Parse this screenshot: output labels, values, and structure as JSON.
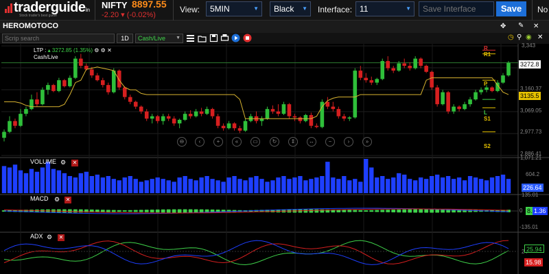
{
  "header": {
    "logo_text": "traderguide",
    "logo_suffix": "in",
    "logo_tagline": "Stock trader's best guide",
    "ticker_name": "NIFTY",
    "ticker_price": "8897.55",
    "ticker_change": "-2.20 ▾ (-0.02%)",
    "view_label": "View:",
    "view_value": "5MIN",
    "theme_value": "Black",
    "interface_label": "Interface:",
    "interface_value": "11",
    "save_placeholder": "Save Interface",
    "save_label": "Save",
    "clipped_label": "No"
  },
  "chart": {
    "symbol": "HEROMOTOCO",
    "search_placeholder": "Scrip search",
    "timeframe": "1D",
    "mode": "Cash/Live",
    "ltp_label": "LTP :",
    "ltp_change": "▴ 3272.85 (1.35%)",
    "ltp_mode": "Cash/Live"
  },
  "price_axis": {
    "ticks": [
      "3,343",
      "3,251.6",
      "3,160.37",
      "3,069.05",
      "2,977.73",
      "2,886.41"
    ],
    "ltp_tag": "3272.8",
    "ma_tag": "3135.5"
  },
  "pivots": {
    "labels": [
      "R",
      "R1",
      "P",
      "L",
      "S1",
      "S2"
    ],
    "colors": {
      "R": "#e03030",
      "R1": "#e6c200",
      "P": "#e6c200",
      "L": "#3fd34a",
      "S1": "#e6c200",
      "S2": "#e6c200"
    }
  },
  "panels": {
    "volume": {
      "title": "VOLUME",
      "ticks": [
        "1,071.21",
        "604.2"
      ],
      "tag": "226.64"
    },
    "macd": {
      "title": "MACD",
      "ticks": [
        "135.01",
        "0",
        "-135.01"
      ],
      "tag_a": "8.36",
      "tag_b": "1.36"
    },
    "adx": {
      "title": "ADX",
      "ticks": [
        "24"
      ],
      "tag_green": "25.94",
      "tag_red": "15.98"
    }
  },
  "colors": {
    "up": "#2fbf3a",
    "down": "#d61f1f",
    "ma": "#d9b430",
    "volume": "#1e3fff",
    "grid": "#2b2b2b",
    "save": "#1d6fd8"
  },
  "icons": {
    "plot_tools": [
      "bars-icon",
      "open-icon",
      "save-icon",
      "print-icon",
      "play-icon",
      "stop-icon"
    ],
    "header_tools": [
      "move-icon",
      "pin-icon",
      "clock-icon",
      "search-icon",
      "eye-icon",
      "tools-icon"
    ],
    "nav": [
      "zoom-out-icon",
      "back-icon",
      "plus-icon",
      "first-icon",
      "fit-icon",
      "reload-icon",
      "up-icon",
      "split-icon",
      "minus-icon",
      "forward-icon",
      "end-icon"
    ]
  },
  "chart_data": {
    "type": "candlestick",
    "series": [
      {
        "name": "",
        "ohlc": [
          [
            2960,
            2995,
            2945,
            2985
          ],
          [
            2985,
            3050,
            2980,
            3030
          ],
          [
            3030,
            3040,
            3000,
            3010
          ],
          [
            3010,
            3080,
            3005,
            3060
          ],
          [
            3060,
            3090,
            3050,
            3080
          ],
          [
            3080,
            3140,
            3075,
            3120
          ],
          [
            3120,
            3150,
            3090,
            3100
          ],
          [
            3100,
            3170,
            3095,
            3160
          ],
          [
            3160,
            3190,
            3140,
            3180
          ],
          [
            3180,
            3185,
            3150,
            3155
          ],
          [
            3155,
            3210,
            3150,
            3200
          ],
          [
            3200,
            3205,
            3170,
            3175
          ],
          [
            3175,
            3220,
            3170,
            3210
          ],
          [
            3210,
            3300,
            3205,
            3290
          ],
          [
            3290,
            3310,
            3250,
            3260
          ],
          [
            3260,
            3270,
            3240,
            3245
          ],
          [
            3245,
            3255,
            3210,
            3220
          ],
          [
            3220,
            3230,
            3195,
            3200
          ],
          [
            3200,
            3210,
            3170,
            3180
          ],
          [
            3180,
            3190,
            3140,
            3150
          ],
          [
            3150,
            3250,
            3145,
            3240
          ],
          [
            3240,
            3245,
            3160,
            3170
          ],
          [
            3170,
            3175,
            3120,
            3130
          ],
          [
            3130,
            3140,
            3100,
            3110
          ],
          [
            3110,
            3115,
            3080,
            3090
          ],
          [
            3090,
            3095,
            3060,
            3070
          ],
          [
            3070,
            3080,
            3030,
            3040
          ],
          [
            3040,
            3060,
            3020,
            3050
          ],
          [
            3050,
            3055,
            3020,
            3030
          ],
          [
            3030,
            3060,
            3015,
            3050
          ],
          [
            3050,
            3060,
            3030,
            3040
          ],
          [
            3040,
            3050,
            3010,
            3020
          ],
          [
            3020,
            3040,
            3000,
            3035
          ],
          [
            3035,
            3070,
            3030,
            3060
          ],
          [
            3060,
            3075,
            3040,
            3050
          ],
          [
            3050,
            3080,
            3045,
            3070
          ],
          [
            3070,
            3085,
            3050,
            3060
          ],
          [
            3060,
            3090,
            3055,
            3080
          ],
          [
            3080,
            3085,
            3040,
            3050
          ],
          [
            3050,
            3060,
            3000,
            3010
          ],
          [
            3010,
            3020,
            2990,
            3000
          ],
          [
            3000,
            3030,
            2995,
            3020
          ],
          [
            3020,
            3025,
            2990,
            3000
          ],
          [
            3000,
            3010,
            2980,
            2990
          ],
          [
            2990,
            3040,
            2985,
            3030
          ],
          [
            3030,
            3060,
            3025,
            3050
          ],
          [
            3050,
            3070,
            3020,
            3030
          ],
          [
            3030,
            3050,
            3010,
            3040
          ],
          [
            3040,
            3090,
            3035,
            3080
          ],
          [
            3080,
            3095,
            3060,
            3070
          ],
          [
            3070,
            3100,
            3050,
            3060
          ],
          [
            3060,
            3110,
            3055,
            3100
          ],
          [
            3100,
            3105,
            3040,
            3050
          ],
          [
            3050,
            3060,
            3030,
            3045
          ],
          [
            3045,
            3050,
            3020,
            3030
          ],
          [
            3030,
            3060,
            3025,
            3055
          ],
          [
            3055,
            3065,
            3000,
            3010
          ],
          [
            3010,
            3020,
            3000,
            3005
          ],
          [
            3005,
            3120,
            3000,
            3110
          ],
          [
            3110,
            3130,
            3080,
            3090
          ],
          [
            3090,
            3110,
            3070,
            3080
          ],
          [
            3080,
            3090,
            3040,
            3050
          ],
          [
            3050,
            3060,
            3030,
            3040
          ],
          [
            3040,
            3050,
            3030,
            3045
          ],
          [
            3045,
            3250,
            3040,
            3240
          ],
          [
            3240,
            3260,
            3200,
            3210
          ],
          [
            3210,
            3230,
            3190,
            3200
          ],
          [
            3200,
            3215,
            3180,
            3190
          ],
          [
            3190,
            3210,
            3180,
            3205
          ],
          [
            3205,
            3290,
            3200,
            3280
          ],
          [
            3280,
            3300,
            3240,
            3250
          ],
          [
            3250,
            3260,
            3230,
            3240
          ],
          [
            3240,
            3280,
            3235,
            3270
          ],
          [
            3270,
            3290,
            3250,
            3260
          ],
          [
            3260,
            3275,
            3240,
            3250
          ],
          [
            3250,
            3300,
            3245,
            3290
          ],
          [
            3290,
            3295,
            3250,
            3260
          ],
          [
            3260,
            3265,
            3230,
            3235
          ],
          [
            3235,
            3240,
            3160,
            3170
          ],
          [
            3170,
            3180,
            3090,
            3100
          ],
          [
            3100,
            3160,
            3095,
            3150
          ],
          [
            3150,
            3155,
            3060,
            3070
          ],
          [
            3070,
            3100,
            3060,
            3090
          ],
          [
            3090,
            3095,
            3070,
            3080
          ],
          [
            3080,
            3110,
            3075,
            3100
          ],
          [
            3100,
            3130,
            3090,
            3120
          ],
          [
            3120,
            3160,
            3115,
            3150
          ],
          [
            3150,
            3170,
            3140,
            3160
          ],
          [
            3160,
            3180,
            3150,
            3170
          ],
          [
            3170,
            3175,
            3150,
            3155
          ],
          [
            3155,
            3200,
            3150,
            3190
          ],
          [
            3190,
            3230,
            3185,
            3220
          ],
          [
            3220,
            3280,
            3215,
            3272.85
          ]
        ]
      },
      {
        "name": "",
        "type": "line",
        "values": [
          3110,
          3110,
          3110,
          3105,
          3095,
          3090,
          3090,
          3090,
          3090,
          3090,
          3090,
          3100,
          3140,
          3190,
          3200,
          3245,
          3250,
          3255,
          3250,
          3245,
          3240,
          3200,
          3170,
          3160,
          3160,
          3145,
          3140,
          3140,
          3140,
          3140,
          3140,
          3140,
          3140,
          3140,
          3140,
          3140,
          3140,
          3140,
          3140,
          3140,
          3140,
          3140,
          3140,
          3120,
          3040,
          3040,
          3040,
          3040,
          3040,
          3040,
          3040,
          3040,
          3040,
          3040,
          3040,
          3040,
          3040,
          3050,
          3090,
          3115,
          3125,
          3130,
          3130,
          3130,
          3130,
          3140,
          3140,
          3140,
          3140,
          3140,
          3140,
          3140,
          3140,
          3140,
          3140,
          3140,
          3140,
          3200,
          3210,
          3210,
          3210,
          3210,
          3210,
          3210,
          3210,
          3210,
          3210,
          3210,
          3210,
          3210,
          3180,
          3150,
          3140
        ]
      }
    ],
    "volume": [
      95,
      90,
      100,
      80,
      70,
      85,
      75,
      90,
      110,
      85,
      80,
      70,
      60,
      55,
      70,
      75,
      60,
      65,
      55,
      60,
      50,
      45,
      55,
      60,
      50,
      40,
      45,
      50,
      55,
      50,
      45,
      40,
      55,
      60,
      50,
      45,
      55,
      60,
      50,
      45,
      40,
      55,
      60,
      50,
      45,
      55,
      60,
      50,
      40,
      45,
      55,
      60,
      50,
      55,
      60,
      45,
      50,
      55,
      60,
      110,
      55,
      50,
      60,
      45,
      50,
      40,
      120,
      90,
      55,
      60,
      50,
      55,
      70,
      65,
      50,
      45,
      55,
      50,
      60,
      65,
      55,
      60,
      50,
      55,
      45,
      60,
      55,
      50,
      45,
      55,
      60,
      65,
      50
    ],
    "ylim": [
      2886.41,
      3343
    ]
  }
}
